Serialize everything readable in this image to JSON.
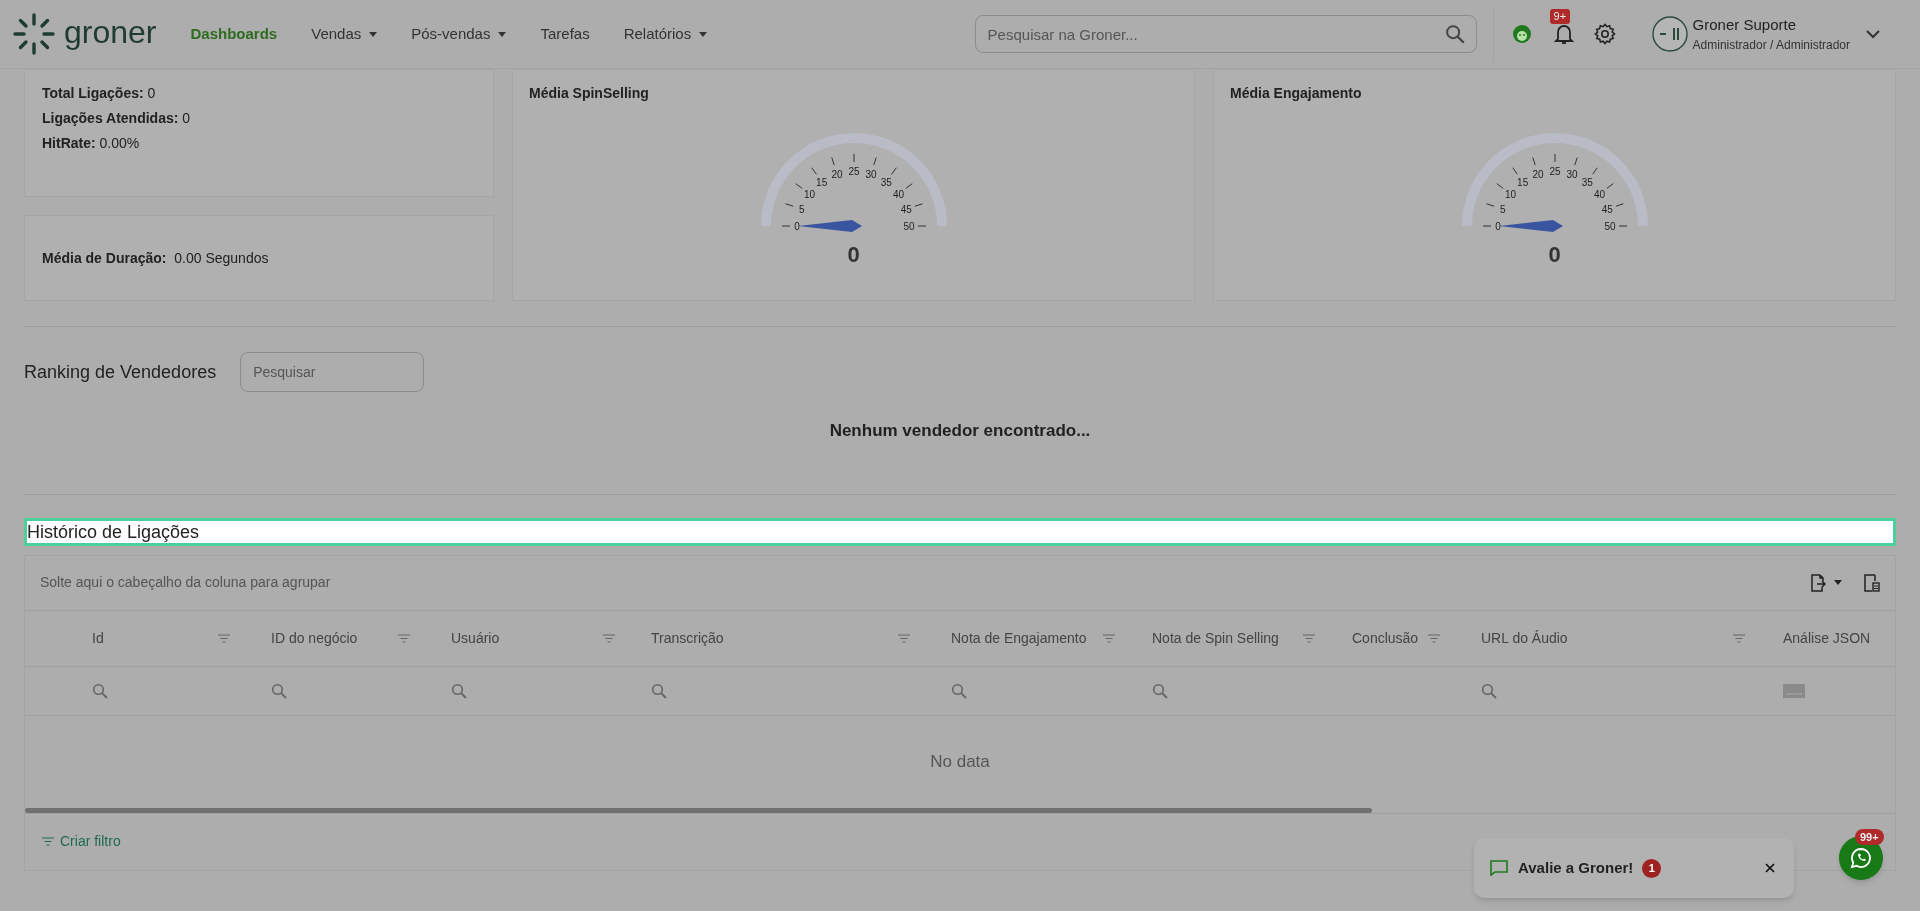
{
  "header": {
    "brand": "groner",
    "nav": [
      {
        "label": "Dashboards",
        "selected": true,
        "dropdown": false
      },
      {
        "label": "Vendas",
        "selected": false,
        "dropdown": true
      },
      {
        "label": "Pós-vendas",
        "selected": false,
        "dropdown": true
      },
      {
        "label": "Tarefas",
        "selected": false,
        "dropdown": false
      },
      {
        "label": "Relatórios",
        "selected": false,
        "dropdown": true
      }
    ],
    "search": {
      "placeholder": "Pesquisar na Groner..."
    },
    "notifications_badge": "9+",
    "user": {
      "name": "Groner Suporte",
      "role": "Administrador / Administrador"
    }
  },
  "stats": [
    {
      "label": "Total Ligações:",
      "value": "0"
    },
    {
      "label": "Ligações Atendidas:",
      "value": "0"
    },
    {
      "label": "HitRate:",
      "value": "0.00%"
    }
  ],
  "duration": {
    "label": "Média de Duração:",
    "value": "0.00 Segundos"
  },
  "gauges": [
    {
      "title": "Média SpinSelling",
      "scale_labels": [
        "0",
        "5",
        "10",
        "15",
        "20",
        "25",
        "30",
        "35",
        "40",
        "45",
        "50"
      ],
      "value": "0"
    },
    {
      "title": "Média Engajamento",
      "scale_labels": [
        "0",
        "5",
        "10",
        "15",
        "20",
        "25",
        "30",
        "35",
        "40",
        "45",
        "50"
      ],
      "value": "0"
    }
  ],
  "ranking": {
    "title": "Ranking de Vendedores",
    "search": {
      "placeholder": "Pesquisar"
    },
    "empty": "Nenhum vendedor encontrado..."
  },
  "history": {
    "title": "Histórico de Ligações",
    "group_hint": "Solte aqui o cabeçalho da coluna para agrupar",
    "columns": [
      {
        "label": "Id",
        "kind": "search",
        "menu": true
      },
      {
        "label": "ID do negócio",
        "kind": "search",
        "menu": true
      },
      {
        "label": "Usuário",
        "kind": "search",
        "menu": true
      },
      {
        "label": "Transcrição",
        "kind": "search",
        "menu": true
      },
      {
        "label": "Nota de Engajamento",
        "kind": "search",
        "menu": true
      },
      {
        "label": "Nota de Spin Selling",
        "kind": "search",
        "menu": true
      },
      {
        "label": "Conclusão",
        "kind": "none",
        "menu": true
      },
      {
        "label": "URL do Áudio",
        "kind": "search",
        "menu": true
      },
      {
        "label": "Análise JSON",
        "kind": "text",
        "menu": false
      }
    ],
    "empty": "No data",
    "create_filter": "Criar filtro"
  },
  "toast": {
    "text": "Avalie a Groner!",
    "badge": "1"
  },
  "chat_badge": "99+"
}
